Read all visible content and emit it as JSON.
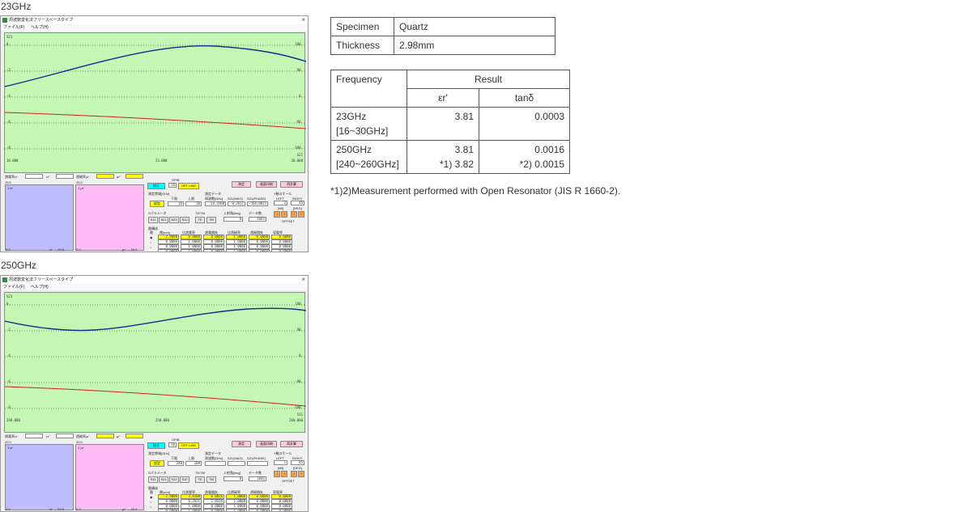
{
  "sections": [
    {
      "label": "23GHz",
      "window_title": "周波数変化法フリースペースタイプ",
      "menu": [
        "ファイル(F)",
        "ヘルプ(H)"
      ],
      "graph": {
        "left_label": "S21",
        "left_ticks": [
          "0.",
          "-2.",
          "-4.",
          "-6.",
          "-8."
        ],
        "right_ticks": [
          "180.",
          "90.",
          "0.",
          "-90.",
          "-180."
        ],
        "x_start": "16.000",
        "x_mid": "23.000",
        "x_end": "30.000",
        "right_unit": "S21"
      },
      "panel": {
        "eps_left": "誘電率εr'",
        "eps_left2": "εr''",
        "mu_left": "透磁率μr'",
        "mu_left2": "μr''",
        "v1": "15.0",
        "v2": "20.0",
        "hist1_label": "1 εr'",
        "hist2_label": "1 μr'",
        "hist1_bottom_l": "0.0",
        "hist1_bottom_r": "εr' → 20.0",
        "hist2_bottom_l": "0.0",
        "hist2_bottom_r": "μr' → 20.0",
        "gpib": "GPIB",
        "btn_conf": "校正",
        "gpib_addr": "16",
        "btn_offline": "OFF LINE",
        "freq_range": "測定帯域[GHz]",
        "lower": "下限",
        "upper": "上限",
        "lower_v": "16",
        "upper_v": "30",
        "btn_set": "設定",
        "meas_data": "測定データ",
        "freq_hdr": "周波数[GHz]",
        "mag_hdr": "S21(MAG)",
        "phase_hdr": "S21(PHASE)",
        "freq_v": "24.3200",
        "mag_v": "-0.2611",
        "phase_v": "-166.8821",
        "btn_measure": "測定",
        "btn_screen": "画面印刷",
        "btn_calc": "再計算",
        "scale": "Y軸スケール",
        "left": "LEFT",
        "right": "RIGHT",
        "scale_l": "2",
        "scale_r": "45",
        "db": "[dB]",
        "deg": "[DEG]",
        "offset": "OFFSET",
        "sparam": "Sパラメータ",
        "s_btns": [
          "S11",
          "S21",
          "S22",
          "S12"
        ],
        "tetm": "TE/TM",
        "te": "TE",
        "tm": "TM",
        "angle": "入射角[deg]",
        "angle_v": "0",
        "npts": "データ数",
        "npts_v": "1601",
        "layer": "層構成",
        "layer_hdr": [
          "層",
          "厚[mm]",
          "比誘電率",
          "誘電損失",
          "比透磁率",
          "透磁損失",
          "導電率"
        ],
        "layers": [
          [
            "2.9800",
            "0.0000",
            "0.0000",
            "1.0000",
            "0.0000",
            "0.0000"
          ],
          [
            "0.0000",
            "1.0000",
            "0.0000",
            "1.0000",
            "0.0000",
            "0.0000"
          ],
          [
            "0.0000",
            "1.0000",
            "0.0000",
            "1.0000",
            "0.0000",
            "0.0000"
          ],
          [
            "0.0000",
            "1.0000",
            "0.0000",
            "1.0000",
            "0.0000",
            "0.0000"
          ]
        ]
      }
    },
    {
      "label": "250GHz",
      "window_title": "周波数変化法フリースペースタイプ",
      "menu": [
        "ファイル(F)",
        "ヘルプ(H)"
      ],
      "graph": {
        "left_label": "S21",
        "left_ticks": [
          "0.",
          "-2.",
          "-4.",
          "-6.",
          "-8."
        ],
        "right_ticks": [
          "180.",
          "90.",
          "0.",
          "-90.",
          "-180."
        ],
        "x_start": "240.000",
        "x_mid": "250.000",
        "x_end": "260.000",
        "right_unit": "S21"
      },
      "panel": {
        "eps_left": "誘電率εr'",
        "eps_left2": "εr''",
        "mu_left": "透磁率μr'",
        "mu_left2": "μr''",
        "v1": "20.0",
        "v2": "20.0",
        "hist1_label": "1 εr'",
        "hist2_label": "1 μr'",
        "hist1_bottom_l": "0.0",
        "hist1_bottom_r": "εr' → 20.0",
        "hist2_bottom_l": "0.0",
        "hist2_bottom_r": "μr' → 20.0",
        "gpib": "GPIB",
        "btn_conf": "校正",
        "gpib_addr": "16",
        "btn_offline": "OFF LINE",
        "freq_range": "測定帯域[GHz]",
        "lower": "下限",
        "upper": "上限",
        "lower_v": "240",
        "upper_v": "260",
        "btn_set": "設定",
        "meas_data": "測定データ",
        "freq_hdr": "周波数[GHz]",
        "mag_hdr": "S21(MAG)",
        "phase_hdr": "S21(PHASE)",
        "freq_v": "",
        "mag_v": "",
        "phase_v": "",
        "btn_measure": "測定",
        "btn_screen": "画面印刷",
        "btn_calc": "再計算",
        "scale": "Y軸スケール",
        "left": "LEFT",
        "right": "RIGHT",
        "scale_l": "1",
        "scale_r": "45",
        "db": "[dB]",
        "deg": "[DEG]",
        "offset": "OFFSET",
        "sparam": "Sパラメータ",
        "s_btns": [
          "S11",
          "S21",
          "S22",
          "S12"
        ],
        "tetm": "TE/TM",
        "te": "TE",
        "tm": "TM",
        "angle": "入射角[deg]",
        "angle_v": "0",
        "npts": "データ数",
        "npts_v": "1601",
        "layer": "層構成",
        "layer_hdr": [
          "層",
          "厚[mm]",
          "比誘電率",
          "誘電損失",
          "比透磁率",
          "透磁損失",
          "導電率"
        ],
        "layers": [
          [
            "2.9800",
            "3.8100",
            "0.0016",
            "1.0000",
            "0.0000",
            "0.0000"
          ],
          [
            "0.0000",
            "6.2921",
            "2.0516",
            "1.0000",
            "0.0000",
            "0.0000"
          ],
          [
            "0.0000",
            "1.0000",
            "0.0000",
            "1.0000",
            "0.0000",
            "0.0000"
          ],
          [
            "0.0000",
            "1.0000",
            "0.0000",
            "1.0000",
            "0.0000",
            "0.0000"
          ]
        ]
      }
    }
  ],
  "specimen_table": {
    "specimen_label": "Specimen",
    "specimen_value": "Quartz",
    "thickness_label": "Thickness",
    "thickness_value": "2.98mm"
  },
  "result_table": {
    "freq_header": "Frequency",
    "result_header": "Result",
    "er_header": "εr'",
    "tand_header": "tanδ",
    "rows": [
      {
        "freq": "23GHz",
        "range": "[16~30GHz]",
        "er": "3.81",
        "er2": "",
        "tand": "0.0003",
        "tand2": ""
      },
      {
        "freq": "250GHz",
        "range": "[240~260GHz]",
        "er": "3.81",
        "er2": "*1) 3.82",
        "tand": "0.0016",
        "tand2": "*2) 0.0015"
      }
    ]
  },
  "footnote": "*1)2)Measurement performed with Open Resonator (JIS R 1660-2).",
  "colors": {
    "graph_bg": "#c4f6b4",
    "mag_curve": "#1c2a8a",
    "phase_curve": "#d02020",
    "eps_hist": "#bcbcff",
    "mu_hist": "#ffbcf4",
    "highlight": "#ffff00",
    "cyan_button": "#00ffff"
  }
}
